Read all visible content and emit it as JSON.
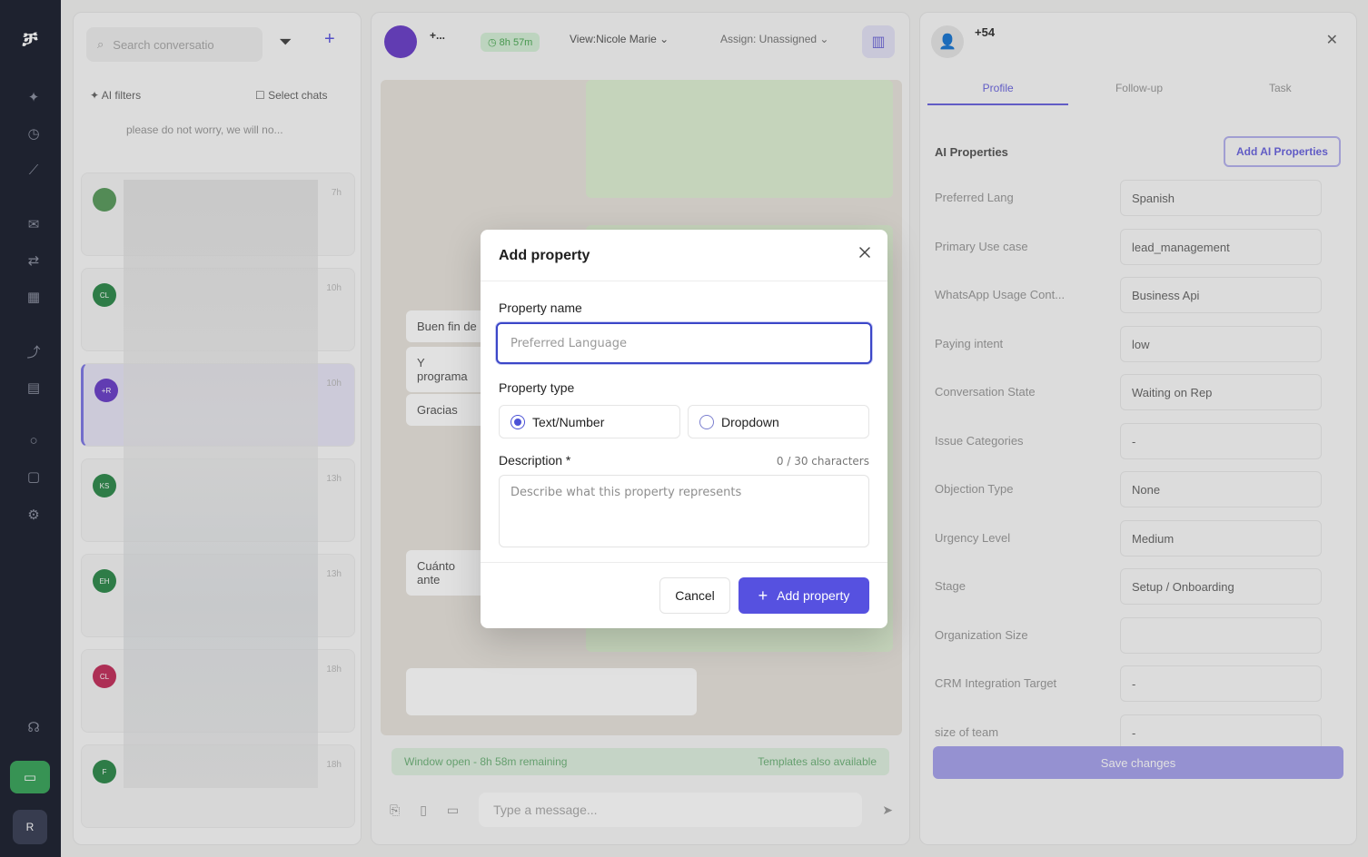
{
  "sidebar": {
    "logo": "ቻ",
    "user_initial": "R"
  },
  "conversations": {
    "search_placeholder": "Search conversatio",
    "ai_filters": "AI filters",
    "select_chats": "Select chats",
    "snippet": "please do not worry, we will no...",
    "rows": [
      {
        "initials": "",
        "time": "7h",
        "color": "#5a9b5e"
      },
      {
        "initials": "CL",
        "time": "10h",
        "color": "#2f8a4c"
      },
      {
        "initials": "+R",
        "time": "10h",
        "color": "#6a3fc9"
      },
      {
        "initials": "KS",
        "time": "13h",
        "color": "#2f8a4c"
      },
      {
        "initials": "EH",
        "time": "13h",
        "color": "#2f8a4c"
      },
      {
        "initials": "CL",
        "time": "18h",
        "color": "#c3305c"
      },
      {
        "initials": "F",
        "time": "18h",
        "color": "#2f8a4c"
      }
    ]
  },
  "chat": {
    "name": "+...",
    "timer": "8h 57m",
    "view_label": "View:Nicole Marie",
    "assign_label": "Assign: Unassigned",
    "messages_in": [
      "Buen fin de",
      "Y programa",
      "Gracias",
      "Cuánto ante"
    ],
    "window_status": "Window open - 8h 58m remaining",
    "templates_note": "Templates also available",
    "composer_placeholder": "Type a message..."
  },
  "profile": {
    "phone": "+54",
    "profile_badge": "Profile",
    "tabs": [
      "Profile",
      "Follow-up",
      "Task"
    ],
    "ai_title": "AI Properties",
    "add_ai_button": "Add AI Properties",
    "properties": [
      {
        "label": "Preferred Lang",
        "value": "Spanish"
      },
      {
        "label": "Primary Use case",
        "value": "lead_management"
      },
      {
        "label": "WhatsApp Usage Cont...",
        "value": "Business Api"
      },
      {
        "label": "Paying intent",
        "value": "low"
      },
      {
        "label": "Conversation State",
        "value": "Waiting on Rep"
      },
      {
        "label": "Issue Categories",
        "value": "-"
      },
      {
        "label": "Objection Type",
        "value": "None"
      },
      {
        "label": "Urgency Level",
        "value": "Medium"
      },
      {
        "label": "Stage",
        "value": "Setup / Onboarding"
      },
      {
        "label": "Organization Size",
        "value": ""
      },
      {
        "label": "CRM Integration Target",
        "value": "-"
      },
      {
        "label": "size of team",
        "value": "-"
      }
    ],
    "save_button": "Save changes"
  },
  "modal": {
    "title": "Add property",
    "property_name_label": "Property name",
    "property_name_placeholder": "Preferred Language",
    "property_name_value": "",
    "property_type_label": "Property type",
    "type_options": [
      {
        "label": "Text/Number",
        "selected": true
      },
      {
        "label": "Dropdown",
        "selected": false
      }
    ],
    "description_label": "Description *",
    "char_count": "0 / 30 characters",
    "description_placeholder": "Describe what this property represents",
    "cancel_label": "Cancel",
    "add_label": "Add property"
  },
  "colors": {
    "accent": "#5651e0",
    "focus_border": "#3b46c8",
    "rail": "#1c2130"
  }
}
